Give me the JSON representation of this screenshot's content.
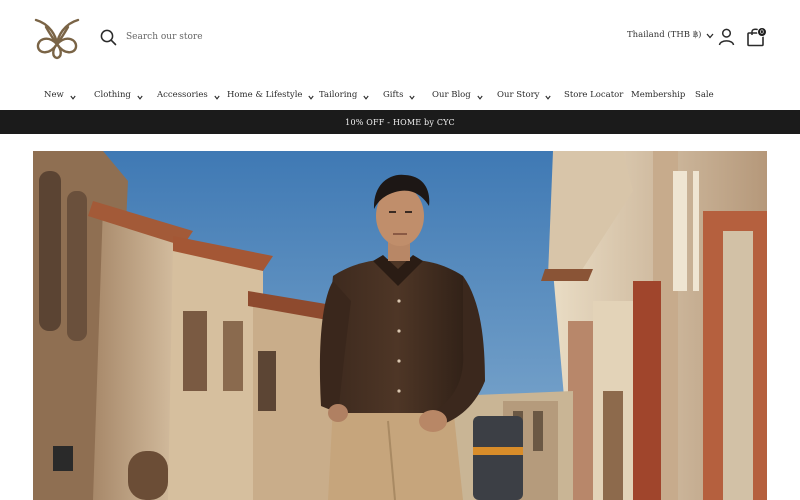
{
  "header": {
    "logo_icon": "monogram-logo-icon",
    "search": {
      "placeholder": "Search our store",
      "icon": "search-icon"
    },
    "region": {
      "label": "Thailand (THB ฿)",
      "icon": "chevron-down-icon"
    },
    "account_icon": "user-icon",
    "cart": {
      "icon": "shopping-bag-icon",
      "count": "0"
    }
  },
  "nav": {
    "items": [
      {
        "label": "New",
        "has_dropdown": true
      },
      {
        "label": "Clothing",
        "has_dropdown": true
      },
      {
        "label": "Accessories",
        "has_dropdown": true
      },
      {
        "label": "Home & Lifestyle",
        "has_dropdown": true
      },
      {
        "label": "Tailoring",
        "has_dropdown": true
      },
      {
        "label": "Gifts",
        "has_dropdown": true
      },
      {
        "label": "Our Blog",
        "has_dropdown": true
      },
      {
        "label": "Our Story",
        "has_dropdown": true
      },
      {
        "label": "Store Locator",
        "has_dropdown": false
      },
      {
        "label": "Membership",
        "has_dropdown": false
      },
      {
        "label": "Sale",
        "has_dropdown": false
      }
    ]
  },
  "announcement": {
    "text": "10% OFF - HOME by CYC"
  },
  "hero": {
    "image": "hero-photo-man-in-brown-shirt-street"
  },
  "colors": {
    "logo": "#7a6446",
    "announcement_bg": "#1b1b1b",
    "announcement_text": "#f2f2f2",
    "text": "#2b2b2b"
  }
}
